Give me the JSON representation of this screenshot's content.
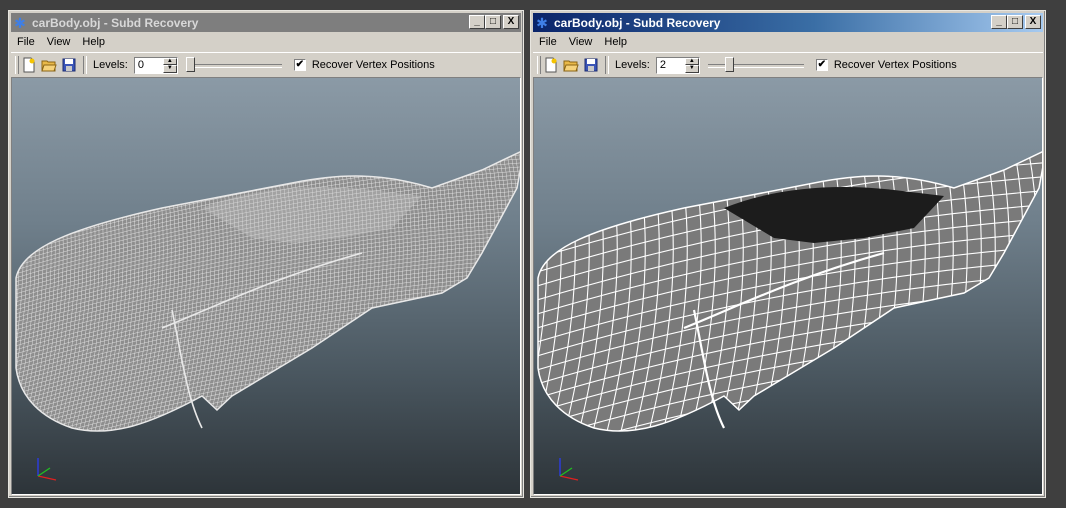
{
  "windows": [
    {
      "title": "carBody.obj - Subd Recovery",
      "active": false,
      "menu": [
        "File",
        "View",
        "Help"
      ],
      "toolbar": {
        "levels_label": "Levels:",
        "levels_value": "0",
        "recover_label": "Recover Vertex Positions",
        "recover_checked": true,
        "slider_fraction": 0
      },
      "buttons": {
        "minimize": "_",
        "maximize": "□",
        "close": "X"
      },
      "mesh_density": "dense"
    },
    {
      "title": "carBody.obj - Subd Recovery",
      "active": true,
      "menu": [
        "File",
        "View",
        "Help"
      ],
      "toolbar": {
        "levels_label": "Levels:",
        "levels_value": "2",
        "recover_label": "Recover Vertex Positions",
        "recover_checked": true,
        "slider_fraction": 0.2
      },
      "buttons": {
        "minimize": "_",
        "maximize": "□",
        "close": "X"
      },
      "mesh_density": "coarse"
    }
  ],
  "icons": {
    "app": "app-icon",
    "new": "new-file-icon",
    "open": "open-folder-icon",
    "save": "save-disk-icon"
  },
  "colors": {
    "active_title_start": "#0a246a",
    "active_title_end": "#a6caf0",
    "inactive_title": "#7e7e7e",
    "wire_dense": "#e8e8e8",
    "wire_coarse": "#ffffff",
    "surface": "#7a7a7a"
  }
}
